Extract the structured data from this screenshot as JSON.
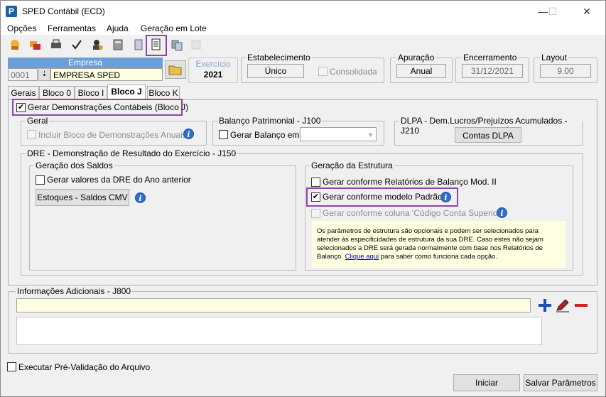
{
  "window": {
    "title": "SPED Contábil (ECD)",
    "minimize": "—",
    "maximize": "☐",
    "close": "✕"
  },
  "menu": [
    "Opções",
    "Ferramentas",
    "Ajuda",
    "Geração em Lote"
  ],
  "toolbar": {
    "icons": [
      "hand-icon",
      "folders-icon",
      "printer-lock-icon",
      "checkmark-icon",
      "user-gear-icon",
      "calculator-icon",
      "book-icon",
      "ledger-icon",
      "copy-icon",
      "disabled-icon"
    ]
  },
  "header": {
    "empresa_label": "Empresa",
    "empresa_code": "0001",
    "empresa_name": "EMPRESA SPED",
    "exercicio_label": "Exercício",
    "exercicio_value": "2021",
    "estabelecimento_label": "Estabelecimento",
    "estabelecimento_value": "Único",
    "consolidada_label": "Consolidada",
    "apuracao_label": "Apuração",
    "apuracao_value": "Anual",
    "encerramento_label": "Encerramento",
    "encerramento_value": "31/12/2021",
    "layout_label": "Layout",
    "layout_value": "9.00"
  },
  "tabs": [
    "Gerais",
    "Bloco 0",
    "Bloco I",
    "Bloco J",
    "Bloco K"
  ],
  "bloco_j": {
    "gerar_demonstracoes": "Gerar Demonstrações Contábeis (Bloco J)",
    "geral_title": "Geral",
    "incluir_bloco": "Incluir Bloco de Demonstrações Anuais",
    "balanco_title": "Balanço Patrimonial - J100",
    "gerar_balanco": "Gerar Balanço em",
    "dlpa_title": "DLPA - Dem.Lucros/Prejuízos Acumulados - J210",
    "contas_dlpa": "Contas DLPA",
    "dre_title": "DRE - Demonstração de Resultado do Exercício - J150",
    "saldos_title": "Geração dos Saldos",
    "gerar_valores_dre": "Gerar valores da DRE do Ano anterior",
    "estoques_button": "Estoques - Saldos CMV",
    "estrutura_title": "Geração da Estrutura",
    "opt_relatorios": "Gerar conforme Relatórios de Balanço Mod. II",
    "opt_padrao": "Gerar conforme modelo Padrão",
    "opt_coluna": "Gerar conforme coluna 'Código Conta Superior'",
    "notice_text": "Os parâmetros de estrutura são opcionais e podem ser selecionados para atender às especificidades de estrutura da sua DRE. Caso estes não sejam selecionados a DRE será gerada normalmente com base nos Relatórios de Balanço.",
    "notice_link": "Clique aqui",
    "notice_tail": " para saber como funciona cada opção."
  },
  "info_adicionais": {
    "title": "Informações Adicionais - J800"
  },
  "footer": {
    "pre_validacao": "Executar Pré-Validação do Arquivo",
    "iniciar": "Iniciar",
    "salvar": "Salvar Parâmetros"
  }
}
